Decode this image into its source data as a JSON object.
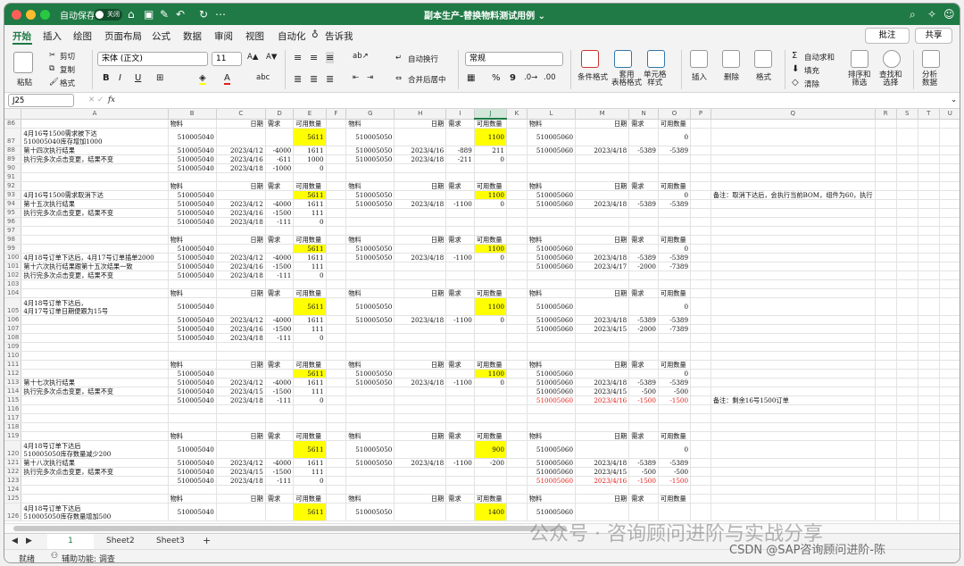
{
  "titlebar": {
    "autosave_label": "自动保存",
    "autosave_state": "关闭",
    "title": "副本生产-替换物料测试用例 ⌄"
  },
  "tabs": [
    "开始",
    "插入",
    "绘图",
    "页面布局",
    "公式",
    "数据",
    "审阅",
    "视图",
    "自动化",
    "告诉我"
  ],
  "buttons": {
    "comment": "批注",
    "share": "共享"
  },
  "ribbon": {
    "paste": "粘贴",
    "cut": "剪切",
    "copy": "复制",
    "format_painter": "格式",
    "font_name": "宋体 (正文)",
    "font_size": "11",
    "wrap": "自动换行",
    "merge": "合并后居中",
    "number_format": "常规",
    "cond_format": "条件格式",
    "table_format": "套用\n表格格式",
    "cell_style": "单元格\n样式",
    "insert": "插入",
    "delete": "删除",
    "format": "格式",
    "autosum": "自动求和",
    "fill": "填充",
    "clear": "清除",
    "sort": "排序和\n筛选",
    "find": "查找和\n选择",
    "analyze": "分析\n数据"
  },
  "formula_bar": {
    "name_box": "J25",
    "fx": "fx",
    "value": ""
  },
  "columns": [
    "A",
    "B",
    "C",
    "D",
    "E",
    "F",
    "G",
    "H",
    "I",
    "J",
    "K",
    "L",
    "M",
    "N",
    "O",
    "P",
    "Q",
    "R",
    "S",
    "T",
    "U"
  ],
  "selected_col": "J",
  "rows": [
    {
      "n": "86",
      "c": [
        "",
        "物料",
        "日期",
        "需求",
        "可用数量",
        "",
        "物料",
        "日期",
        "需求",
        "可用数量",
        "",
        "物料",
        "日期",
        "需求",
        "可用数量",
        "",
        "",
        "",
        "",
        "",
        ""
      ]
    },
    {
      "n": "87",
      "c": [
        "4月16号1500需求被下达\n510005040库存增加1000",
        "510005040",
        "",
        "",
        "5611",
        "",
        "510005050",
        "",
        "",
        "1100",
        "",
        "510005060",
        "",
        "",
        "0",
        "",
        "",
        "",
        "",
        "",
        ""
      ],
      "y": [
        4,
        9
      ],
      "tall": true
    },
    {
      "n": "88",
      "c": [
        "第十四次执行结果",
        "510005040",
        "2023/4/12",
        "-4000",
        "1611",
        "",
        "510005050",
        "2023/4/16",
        "-889",
        "211",
        "",
        "510005060",
        "2023/4/18",
        "-5389",
        "-5389",
        "",
        "",
        "",
        "",
        "",
        ""
      ]
    },
    {
      "n": "89",
      "c": [
        "执行完多次点击变更，结果不变",
        "510005040",
        "2023/4/16",
        "-611",
        "1000",
        "",
        "510005050",
        "2023/4/18",
        "-211",
        "0",
        "",
        "",
        "",
        "",
        "",
        "",
        "",
        "",
        "",
        "",
        ""
      ]
    },
    {
      "n": "90",
      "c": [
        "",
        "510005040",
        "2023/4/18",
        "-1000",
        "0",
        "",
        "",
        "",
        "",
        "",
        "",
        "",
        "",
        "",
        "",
        "",
        "",
        "",
        "",
        "",
        ""
      ]
    },
    {
      "n": "91",
      "c": [
        "",
        "",
        "",
        "",
        "",
        "",
        "",
        "",
        "",
        "",
        "",
        "",
        "",
        "",
        "",
        "",
        "",
        "",
        "",
        "",
        ""
      ]
    },
    {
      "n": "92",
      "c": [
        "",
        "物料",
        "日期",
        "需求",
        "可用数量",
        "",
        "物料",
        "日期",
        "需求",
        "可用数量",
        "",
        "物料",
        "日期",
        "需求",
        "可用数量",
        "",
        "",
        "",
        "",
        "",
        ""
      ]
    },
    {
      "n": "93",
      "c": [
        "4月16号1500需求取消下达",
        "510005040",
        "",
        "",
        "5611",
        "",
        "510005050",
        "",
        "",
        "1100",
        "",
        "510005060",
        "",
        "",
        "0",
        "",
        "备注：取消下达后，会执行当前BOM，组件为60，执行",
        "",
        "",
        "",
        ""
      ],
      "y": [
        4,
        9
      ]
    },
    {
      "n": "94",
      "c": [
        "第十五次执行结果",
        "510005040",
        "2023/4/12",
        "-4000",
        "1611",
        "",
        "510005050",
        "2023/4/18",
        "-1100",
        "0",
        "",
        "510005060",
        "2023/4/18",
        "-5389",
        "-5389",
        "",
        "",
        "",
        "",
        "",
        ""
      ]
    },
    {
      "n": "95",
      "c": [
        "执行完多次点击变更，结果不变",
        "510005040",
        "2023/4/16",
        "-1500",
        "111",
        "",
        "",
        "",
        "",
        "",
        "",
        "",
        "",
        "",
        "",
        "",
        "",
        "",
        "",
        "",
        ""
      ]
    },
    {
      "n": "96",
      "c": [
        "",
        "510005040",
        "2023/4/18",
        "-111",
        "0",
        "",
        "",
        "",
        "",
        "",
        "",
        "",
        "",
        "",
        "",
        "",
        "",
        "",
        "",
        "",
        ""
      ]
    },
    {
      "n": "97",
      "c": [
        "",
        "",
        "",
        "",
        "",
        "",
        "",
        "",
        "",
        "",
        "",
        "",
        "",
        "",
        "",
        "",
        "",
        "",
        "",
        "",
        ""
      ]
    },
    {
      "n": "98",
      "c": [
        "",
        "物料",
        "日期",
        "需求",
        "可用数量",
        "",
        "物料",
        "日期",
        "需求",
        "可用数量",
        "",
        "物料",
        "日期",
        "需求",
        "可用数量",
        "",
        "",
        "",
        "",
        "",
        ""
      ]
    },
    {
      "n": "99",
      "c": [
        "",
        "510005040",
        "",
        "",
        "5611",
        "",
        "510005050",
        "",
        "",
        "1100",
        "",
        "510005060",
        "",
        "",
        "0",
        "",
        "",
        "",
        "",
        "",
        ""
      ],
      "y": [
        4,
        9
      ]
    },
    {
      "n": "100",
      "c": [
        "4月18号订单下达后，4月17号订单插单2000",
        "510005040",
        "2023/4/12",
        "-4000",
        "1611",
        "",
        "510005050",
        "2023/4/18",
        "-1100",
        "0",
        "",
        "510005060",
        "2023/4/18",
        "-5389",
        "-5389",
        "",
        "",
        "",
        "",
        "",
        ""
      ]
    },
    {
      "n": "101",
      "c": [
        "第十六次执行结果跟第十五次结果一致",
        "510005040",
        "2023/4/16",
        "-1500",
        "111",
        "",
        "",
        "",
        "",
        "",
        "",
        "510005060",
        "2023/4/17",
        "-2000",
        "-7389",
        "",
        "",
        "",
        "",
        "",
        ""
      ]
    },
    {
      "n": "102",
      "c": [
        "执行完多次点击变更，结果不变",
        "510005040",
        "2023/4/18",
        "-111",
        "0",
        "",
        "",
        "",
        "",
        "",
        "",
        "",
        "",
        "",
        "",
        "",
        "",
        "",
        "",
        "",
        ""
      ]
    },
    {
      "n": "103",
      "c": [
        "",
        "",
        "",
        "",
        "",
        "",
        "",
        "",
        "",
        "",
        "",
        "",
        "",
        "",
        "",
        "",
        "",
        "",
        "",
        "",
        ""
      ]
    },
    {
      "n": "104",
      "c": [
        "",
        "物料",
        "日期",
        "需求",
        "可用数量",
        "",
        "物料",
        "日期",
        "需求",
        "可用数量",
        "",
        "物料",
        "日期",
        "需求",
        "可用数量",
        "",
        "",
        "",
        "",
        "",
        ""
      ]
    },
    {
      "n": "105",
      "c": [
        "4月18号订单下达后，\n4月17号订单日期便跟为15号",
        "510005040",
        "",
        "",
        "5611",
        "",
        "510005050",
        "",
        "",
        "1100",
        "",
        "510005060",
        "",
        "",
        "0",
        "",
        "",
        "",
        "",
        "",
        ""
      ],
      "y": [
        4,
        9
      ],
      "tall": true
    },
    {
      "n": "106",
      "c": [
        "",
        "510005040",
        "2023/4/12",
        "-4000",
        "1611",
        "",
        "510005050",
        "2023/4/18",
        "-1100",
        "0",
        "",
        "510005060",
        "2023/4/18",
        "-5389",
        "-5389",
        "",
        "",
        "",
        "",
        "",
        ""
      ]
    },
    {
      "n": "107",
      "c": [
        "",
        "510005040",
        "2023/4/16",
        "-1500",
        "111",
        "",
        "",
        "",
        "",
        "",
        "",
        "510005060",
        "2023/4/15",
        "-2000",
        "-7389",
        "",
        "",
        "",
        "",
        "",
        ""
      ]
    },
    {
      "n": "108",
      "c": [
        "",
        "510005040",
        "2023/4/18",
        "-111",
        "0",
        "",
        "",
        "",
        "",
        "",
        "",
        "",
        "",
        "",
        "",
        "",
        "",
        "",
        "",
        "",
        ""
      ]
    },
    {
      "n": "109",
      "c": [
        "",
        "",
        "",
        "",
        "",
        "",
        "",
        "",
        "",
        "",
        "",
        "",
        "",
        "",
        "",
        "",
        "",
        "",
        "",
        "",
        ""
      ]
    },
    {
      "n": "110",
      "c": [
        "",
        "",
        "",
        "",
        "",
        "",
        "",
        "",
        "",
        "",
        "",
        "",
        "",
        "",
        "",
        "",
        "",
        "",
        "",
        "",
        ""
      ]
    },
    {
      "n": "111",
      "c": [
        "",
        "物料",
        "日期",
        "需求",
        "可用数量",
        "",
        "物料",
        "日期",
        "需求",
        "可用数量",
        "",
        "物料",
        "日期",
        "需求",
        "可用数量",
        "",
        "",
        "",
        "",
        "",
        ""
      ]
    },
    {
      "n": "112",
      "c": [
        "",
        "510005040",
        "",
        "",
        "5611",
        "",
        "510005050",
        "",
        "",
        "1100",
        "",
        "510005060",
        "",
        "",
        "0",
        "",
        "",
        "",
        "",
        "",
        ""
      ],
      "y": [
        4,
        9
      ]
    },
    {
      "n": "113",
      "c": [
        "第十七次执行结果",
        "510005040",
        "2023/4/12",
        "-4000",
        "1611",
        "",
        "510005050",
        "2023/4/18",
        "-1100",
        "0",
        "",
        "510005060",
        "2023/4/18",
        "-5389",
        "-5389",
        "",
        "",
        "",
        "",
        "",
        ""
      ]
    },
    {
      "n": "114",
      "c": [
        "执行完多次点击变更，结果不变",
        "510005040",
        "2023/4/15",
        "-1500",
        "111",
        "",
        "",
        "",
        "",
        "",
        "",
        "510005060",
        "2023/4/15",
        "-500",
        "-500",
        "",
        "",
        "",
        "",
        "",
        ""
      ]
    },
    {
      "n": "115",
      "c": [
        "",
        "510005040",
        "2023/4/18",
        "-111",
        "0",
        "",
        "",
        "",
        "",
        "",
        "",
        "510005060",
        "2023/4/16",
        "-1500",
        "-1500",
        "",
        "备注：剩余16号1500订单",
        "",
        "",
        "",
        ""
      ],
      "red": [
        11,
        12,
        13,
        14
      ]
    },
    {
      "n": "116",
      "c": [
        "",
        "",
        "",
        "",
        "",
        "",
        "",
        "",
        "",
        "",
        "",
        "",
        "",
        "",
        "",
        "",
        "",
        "",
        "",
        "",
        ""
      ]
    },
    {
      "n": "117",
      "c": [
        "",
        "",
        "",
        "",
        "",
        "",
        "",
        "",
        "",
        "",
        "",
        "",
        "",
        "",
        "",
        "",
        "",
        "",
        "",
        "",
        ""
      ]
    },
    {
      "n": "118",
      "c": [
        "",
        "",
        "",
        "",
        "",
        "",
        "",
        "",
        "",
        "",
        "",
        "",
        "",
        "",
        "",
        "",
        "",
        "",
        "",
        "",
        ""
      ]
    },
    {
      "n": "119",
      "c": [
        "",
        "物料",
        "日期",
        "需求",
        "可用数量",
        "",
        "物料",
        "日期",
        "需求",
        "可用数量",
        "",
        "物料",
        "日期",
        "需求",
        "可用数量",
        "",
        "",
        "",
        "",
        "",
        ""
      ]
    },
    {
      "n": "120",
      "c": [
        "4月18号订单下达后\n510005050库存数量减少200",
        "510005040",
        "",
        "",
        "5611",
        "",
        "510005050",
        "",
        "",
        "900",
        "",
        "510005060",
        "",
        "",
        "0",
        "",
        "",
        "",
        "",
        "",
        ""
      ],
      "y": [
        4,
        9
      ],
      "tall": true
    },
    {
      "n": "121",
      "c": [
        "第十八次执行结果",
        "510005040",
        "2023/4/12",
        "-4000",
        "1611",
        "",
        "510005050",
        "2023/4/18",
        "-1100",
        "-200",
        "",
        "510005060",
        "2023/4/18",
        "-5389",
        "-5389",
        "",
        "",
        "",
        "",
        "",
        ""
      ]
    },
    {
      "n": "122",
      "c": [
        "执行完多次点击变更，结果不变",
        "510005040",
        "2023/4/15",
        "-1500",
        "111",
        "",
        "",
        "",
        "",
        "",
        "",
        "510005060",
        "2023/4/15",
        "-500",
        "-500",
        "",
        "",
        "",
        "",
        "",
        ""
      ]
    },
    {
      "n": "123",
      "c": [
        "",
        "510005040",
        "2023/4/18",
        "-111",
        "0",
        "",
        "",
        "",
        "",
        "",
        "",
        "510005060",
        "2023/4/16",
        "-1500",
        "-1500",
        "",
        "",
        "",
        "",
        "",
        ""
      ],
      "red": [
        11,
        12,
        13,
        14
      ]
    },
    {
      "n": "124",
      "c": [
        "",
        "",
        "",
        "",
        "",
        "",
        "",
        "",
        "",
        "",
        "",
        "",
        "",
        "",
        "",
        "",
        "",
        "",
        "",
        "",
        ""
      ]
    },
    {
      "n": "125",
      "c": [
        "",
        "物料",
        "日期",
        "需求",
        "可用数量",
        "",
        "物料",
        "日期",
        "需求",
        "可用数量",
        "",
        "物料",
        "日期",
        "需求",
        "可用数量",
        "",
        "",
        "",
        "",
        "",
        ""
      ]
    },
    {
      "n": "126",
      "c": [
        "4月18号订单下达后\n510005050库存数量增加500",
        "510005040",
        "",
        "",
        "5611",
        "",
        "510005050",
        "",
        "",
        "1400",
        "",
        "510005060",
        "",
        "",
        "",
        "",
        "",
        "",
        "",
        "",
        ""
      ],
      "y": [
        4,
        9
      ],
      "tall": true
    }
  ],
  "sheets": [
    "1",
    "Sheet2",
    "Sheet3"
  ],
  "status": {
    "ready": "就绪",
    "accessibility": "辅助功能: 调查"
  },
  "watermark": {
    "line1": "公众号 · 咨询顾问进阶与实战分享",
    "line2": "CSDN @SAP咨询顾问进阶-陈"
  },
  "colors": {
    "excel_green": "#1f7a45",
    "highlight": "#ffff00",
    "red_text": "#e0201b"
  }
}
